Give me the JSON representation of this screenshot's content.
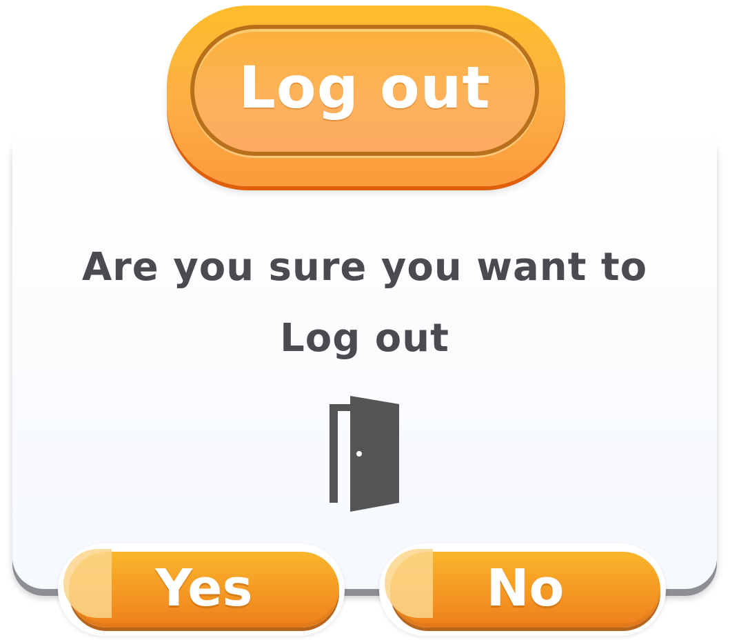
{
  "dialog": {
    "title": "Log out",
    "message_line1": "Are you sure you want to",
    "message_line2": "Log out",
    "icon": "door-open-icon",
    "yes_label": "Yes",
    "no_label": "No"
  },
  "colors": {
    "accent_orange": "#F59A24",
    "title_badge_orange": "#FDB045",
    "text_dark": "#4B4B4F",
    "card_background": "#F9FBFE",
    "icon_color": "#555555"
  }
}
